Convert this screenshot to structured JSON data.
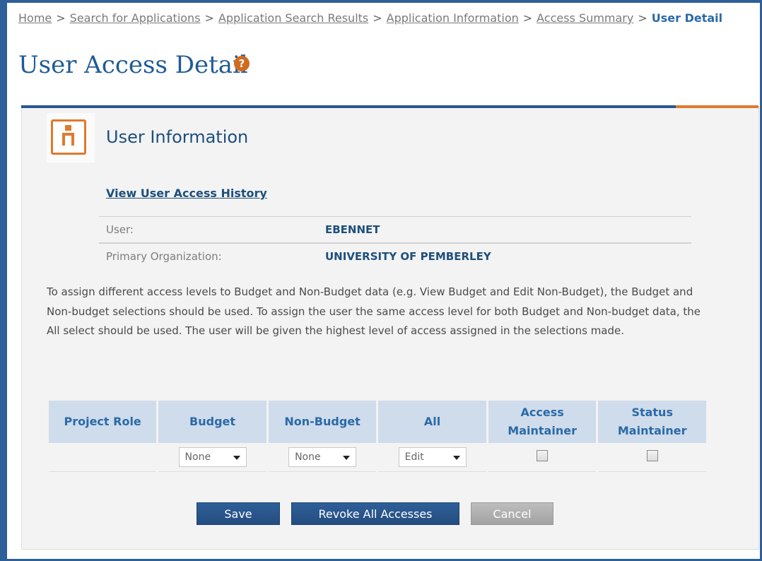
{
  "breadcrumb": {
    "items": [
      "Home",
      "Search for Applications",
      "Application Search Results",
      "Application Information",
      "Access Summary"
    ],
    "current": "User Detail",
    "separator": ">"
  },
  "page": {
    "title": "User Access Detail",
    "help_icon_text": "?"
  },
  "section": {
    "title": "User Information",
    "history_link": "View User Access History"
  },
  "user": {
    "user_label": "User:",
    "user_value": "EBENNET",
    "org_label": "Primary Organization:",
    "org_value": "UNIVERSITY OF PEMBERLEY"
  },
  "instructions": "To assign different access levels to Budget and Non-Budget data (e.g. View Budget and Edit Non-Budget), the Budget and Non-budget selections should be used. To assign the user the same access level for both Budget and Non-budget data, the All select should be used. The user will be given the highest level of access assigned in the selections made.",
  "table": {
    "headers": {
      "project_role": "Project Role",
      "budget": "Budget",
      "non_budget": "Non-Budget",
      "all": "All",
      "access_maintainer_1": "Access",
      "access_maintainer_2": "Maintainer",
      "status_maintainer_1": "Status",
      "status_maintainer_2": "Maintainer"
    },
    "row": {
      "project_role": "",
      "budget": "None",
      "non_budget": "None",
      "all": "Edit",
      "access_maintainer_checked": false,
      "status_maintainer_checked": false
    }
  },
  "buttons": {
    "save": "Save",
    "revoke": "Revoke All Accesses",
    "cancel": "Cancel"
  },
  "colors": {
    "brand_blue": "#2f5f99",
    "accent_orange": "#e07a2e",
    "header_bg": "#cfdceb"
  }
}
